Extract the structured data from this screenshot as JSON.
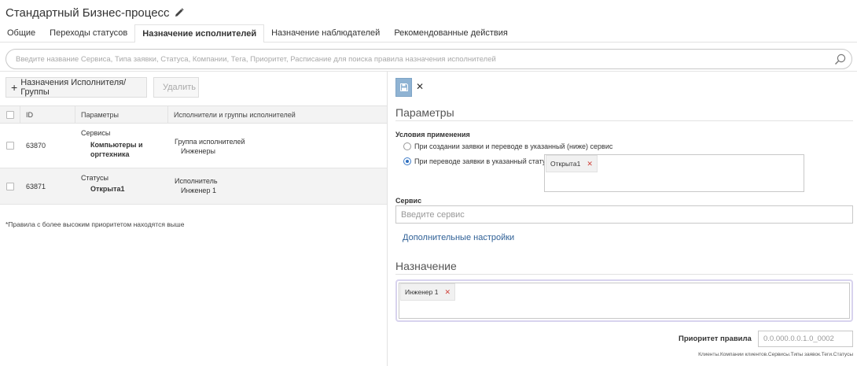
{
  "header": {
    "title": "Стандартный Бизнес-процесс",
    "edit_icon": "pencil-icon"
  },
  "tabs": [
    {
      "label": "Общие",
      "active": false
    },
    {
      "label": "Переходы статусов",
      "active": false
    },
    {
      "label": "Назначение исполнителей",
      "active": true
    },
    {
      "label": "Назначение наблюдателей",
      "active": false
    },
    {
      "label": "Рекомендованные действия",
      "active": false
    }
  ],
  "search": {
    "placeholder": "Введите название Сервиса, Типа заявки, Статуса, Компании, Тега, Приоритет, Расписание для поиска правила назначения исполнителей",
    "icon": "search-icon"
  },
  "toolbar": {
    "add_label": "Назначения Исполнителя/Группы",
    "delete_label": "Удалить"
  },
  "table": {
    "columns": [
      "ID",
      "Параметры",
      "Исполнители и группы исполнителей"
    ],
    "rows": [
      {
        "id": "63870",
        "param_title": "Сервисы",
        "param_value_1": "Компьютеры и",
        "param_value_2": "оргтехника",
        "exec_type": "Группа исполнителей",
        "exec_value": "Инженеры"
      },
      {
        "id": "63871",
        "param_title": "Статусы",
        "param_value_1": "Открыта1",
        "param_value_2": "",
        "exec_type": "Исполнитель",
        "exec_value": "Инженер 1"
      }
    ],
    "footnote": "*Правила с более высоким приоритетом находятся выше"
  },
  "form": {
    "close_glyph": "✕",
    "params_title": "Параметры",
    "conditions_label": "Условия применения",
    "option_create": "При создании заявки и переводе в указанный (ниже) сервис",
    "option_status": "При переводе заявки в указанный статус",
    "status_tag": "Открыта1",
    "service_label": "Сервис",
    "service_placeholder": "Введите сервис",
    "advanced_link": "Дополнительные настройки",
    "assign_title": "Назначение",
    "assign_tag": "Инженер 1",
    "tag_remove_glyph": "✕",
    "priority_label": "Приоритет правила",
    "priority_value": "0.0.000.0.0.1.0_0002",
    "priority_hint": "Клиенты.Компании клиентов.Сервисы.Типы заявок.Теги.Статусы"
  },
  "colors": {
    "accent": "#2f6fbf",
    "save_button": "#8fb3d3",
    "tag_remove": "#d0443c"
  }
}
